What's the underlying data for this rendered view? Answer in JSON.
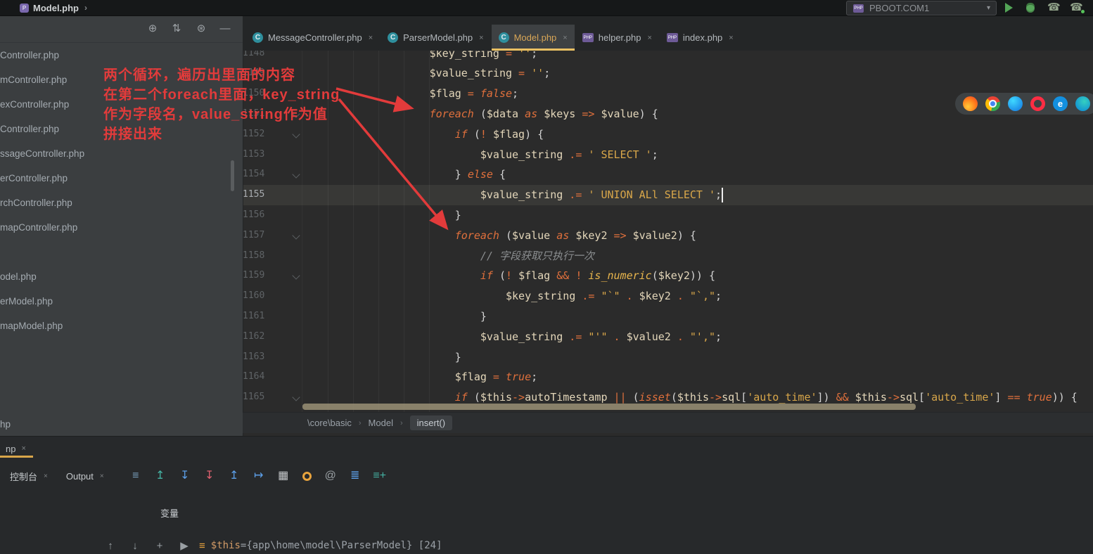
{
  "title_bar": {
    "title": "Model.php",
    "chevron": "›",
    "run_config": {
      "label": "PBOOT.COM1",
      "caret": "▾"
    }
  },
  "project_panel": {
    "toolbar_icons": [
      {
        "name": "locate-file-icon",
        "glyph": "⊕"
      },
      {
        "name": "collapse-all-icon",
        "glyph": "⇅"
      },
      {
        "name": "settings-icon",
        "glyph": "⊛"
      },
      {
        "name": "hide-panel-icon",
        "glyph": "—"
      }
    ],
    "files": [
      "Controller.php",
      "mController.php",
      "exController.php",
      "Controller.php",
      "ssageController.php",
      "erController.php",
      "rchController.php",
      "mapController.php",
      "odel.php",
      "erModel.php",
      "mapModel.php",
      "hp"
    ]
  },
  "editor_tabs": {
    "class_icon_letter": "C",
    "php_icon_letter": "PHP",
    "items": [
      {
        "label": "MessageController.php",
        "kind": "class",
        "close": "×"
      },
      {
        "label": "ParserModel.php",
        "kind": "class",
        "close": "×"
      },
      {
        "label": "Model.php",
        "kind": "class",
        "close": "×",
        "active": true
      },
      {
        "label": "helper.php",
        "kind": "php",
        "close": "×"
      },
      {
        "label": "index.php",
        "kind": "php",
        "close": "×"
      }
    ]
  },
  "editor": {
    "current_line": "1155",
    "breadcrumbs": [
      "\\core\\basic",
      "Model",
      "insert()"
    ],
    "lines": [
      {
        "n": "1148",
        "t": [
          [
            "sp",
            20
          ],
          [
            "var",
            "$key_string"
          ],
          [
            "op",
            " = "
          ],
          [
            "str",
            "''"
          ],
          [
            "pun",
            ";"
          ]
        ]
      },
      {
        "n": "1149",
        "t": [
          [
            "sp",
            20
          ],
          [
            "var",
            "$value_string"
          ],
          [
            "op",
            " = "
          ],
          [
            "str",
            "''"
          ],
          [
            "pun",
            ";"
          ]
        ]
      },
      {
        "n": "1150",
        "t": [
          [
            "sp",
            20
          ],
          [
            "var",
            "$flag"
          ],
          [
            "op",
            " = "
          ],
          [
            "kw",
            "false"
          ],
          [
            "pun",
            ";"
          ]
        ]
      },
      {
        "n": "1151",
        "t": [
          [
            "sp",
            20
          ],
          [
            "kw",
            "foreach"
          ],
          [
            "pun",
            " ("
          ],
          [
            "var",
            "$data"
          ],
          [
            "kw",
            " as "
          ],
          [
            "var",
            "$keys"
          ],
          [
            "op",
            " => "
          ],
          [
            "var",
            "$value"
          ],
          [
            "pun",
            ") {"
          ]
        ]
      },
      {
        "n": "1152",
        "t": [
          [
            "sp",
            24
          ],
          [
            "kw",
            "if"
          ],
          [
            "pun",
            " ("
          ],
          [
            "op",
            "! "
          ],
          [
            "var",
            "$flag"
          ],
          [
            "pun",
            ") {"
          ]
        ]
      },
      {
        "n": "1153",
        "t": [
          [
            "sp",
            28
          ],
          [
            "var",
            "$value_string"
          ],
          [
            "op",
            " .= "
          ],
          [
            "str",
            "' SELECT '"
          ],
          [
            "pun",
            ";"
          ]
        ]
      },
      {
        "n": "1154",
        "t": [
          [
            "sp",
            24
          ],
          [
            "pun",
            "} "
          ],
          [
            "kw",
            "else"
          ],
          [
            "pun",
            " {"
          ]
        ]
      },
      {
        "n": "1155",
        "t": [
          [
            "sp",
            28
          ],
          [
            "var",
            "$value_string"
          ],
          [
            "op",
            " .= "
          ],
          [
            "str",
            "' UNION ALl SELECT '"
          ],
          [
            "pun",
            ";"
          ]
        ]
      },
      {
        "n": "1156",
        "t": [
          [
            "sp",
            24
          ],
          [
            "pun",
            "}"
          ]
        ]
      },
      {
        "n": "1157",
        "t": [
          [
            "sp",
            24
          ],
          [
            "kw",
            "foreach"
          ],
          [
            "pun",
            " ("
          ],
          [
            "var",
            "$value"
          ],
          [
            "kw",
            " as "
          ],
          [
            "var",
            "$key2"
          ],
          [
            "op",
            " => "
          ],
          [
            "var",
            "$value2"
          ],
          [
            "pun",
            ") {"
          ]
        ]
      },
      {
        "n": "1158",
        "t": [
          [
            "sp",
            28
          ],
          [
            "com",
            "// 字段获取只执行一次"
          ]
        ]
      },
      {
        "n": "1159",
        "t": [
          [
            "sp",
            28
          ],
          [
            "kw",
            "if"
          ],
          [
            "pun",
            " ("
          ],
          [
            "op",
            "! "
          ],
          [
            "var",
            "$flag"
          ],
          [
            "op",
            " && "
          ],
          [
            "op",
            "! "
          ],
          [
            "fn",
            "is_numeric"
          ],
          [
            "pun",
            "("
          ],
          [
            "var",
            "$key2"
          ],
          [
            "pun",
            ")) {"
          ]
        ]
      },
      {
        "n": "1160",
        "t": [
          [
            "sp",
            32
          ],
          [
            "var",
            "$key_string"
          ],
          [
            "op",
            " .= "
          ],
          [
            "str",
            "\"`\""
          ],
          [
            "op",
            " . "
          ],
          [
            "var",
            "$key2"
          ],
          [
            "op",
            " . "
          ],
          [
            "str",
            "\"`,\""
          ],
          [
            "pun",
            ";"
          ]
        ]
      },
      {
        "n": "1161",
        "t": [
          [
            "sp",
            28
          ],
          [
            "pun",
            "}"
          ]
        ]
      },
      {
        "n": "1162",
        "t": [
          [
            "sp",
            28
          ],
          [
            "var",
            "$value_string"
          ],
          [
            "op",
            " .= "
          ],
          [
            "str",
            "\"'\""
          ],
          [
            "op",
            " . "
          ],
          [
            "var",
            "$value2"
          ],
          [
            "op",
            " . "
          ],
          [
            "str",
            "\"',\""
          ],
          [
            "pun",
            ";"
          ]
        ]
      },
      {
        "n": "1163",
        "t": [
          [
            "sp",
            24
          ],
          [
            "pun",
            "}"
          ]
        ]
      },
      {
        "n": "1164",
        "t": [
          [
            "sp",
            24
          ],
          [
            "var",
            "$flag"
          ],
          [
            "op",
            " = "
          ],
          [
            "kw",
            "true"
          ],
          [
            "pun",
            ";"
          ]
        ]
      },
      {
        "n": "1165",
        "t": [
          [
            "sp",
            24
          ],
          [
            "kw",
            "if"
          ],
          [
            "pun",
            " ("
          ],
          [
            "var",
            "$this"
          ],
          [
            "op",
            "->"
          ],
          [
            "var",
            "autoTimestamp"
          ],
          [
            "op",
            " || "
          ],
          [
            "pun",
            "("
          ],
          [
            "kw",
            "isset"
          ],
          [
            "pun",
            "("
          ],
          [
            "var",
            "$this"
          ],
          [
            "op",
            "->"
          ],
          [
            "var",
            "sql"
          ],
          [
            "pun",
            "["
          ],
          [
            "str",
            "'auto_time'"
          ],
          [
            "pun",
            "])"
          ],
          [
            "op",
            " && "
          ],
          [
            "var",
            "$this"
          ],
          [
            "op",
            "->"
          ],
          [
            "var",
            "sql"
          ],
          [
            "pun",
            "["
          ],
          [
            "str",
            "'auto_time'"
          ],
          [
            "pun",
            "]"
          ],
          [
            "op",
            " == "
          ],
          [
            "kw",
            "true"
          ],
          [
            "pun",
            ")) {"
          ]
        ]
      }
    ]
  },
  "annotations": {
    "lines": [
      "两个循环，遍历出里面的内容",
      "在第二个foreach里面，key_string",
      "作为字段名，value_string作为值",
      "拼接出来"
    ]
  },
  "browser_popup": [
    {
      "name": "firefox-icon",
      "cls": "b-firefox",
      "letter": ""
    },
    {
      "name": "chrome-icon",
      "cls": "b-chrome",
      "letter": ""
    },
    {
      "name": "safari-icon",
      "cls": "b-safari",
      "letter": ""
    },
    {
      "name": "opera-icon",
      "cls": "b-opera",
      "letter": ""
    },
    {
      "name": "edge-icon",
      "cls": "b-edge",
      "letter": "e"
    },
    {
      "name": "edge-dev-icon",
      "cls": "b-edgedev",
      "letter": ""
    }
  ],
  "debug_panel": {
    "tab": "np",
    "tab_close": "×",
    "console_tab": "控制台",
    "console_close": "×",
    "output_tab": "Output",
    "output_close": "×",
    "variables_label": "变量",
    "toolbar_icons": [
      {
        "name": "view-options-icon",
        "glyph": "≡",
        "color": "#7ba3c0"
      },
      {
        "name": "show-execution-point-icon",
        "glyph": "↥",
        "color": "#45b3a4"
      },
      {
        "name": "step-into-icon",
        "glyph": "↧",
        "color": "#5c9fe8"
      },
      {
        "name": "force-step-into-icon",
        "glyph": "↧",
        "color": "#e06070"
      },
      {
        "name": "step-out-icon",
        "glyph": "↥",
        "color": "#5c9fe8"
      },
      {
        "name": "run-to-cursor-icon",
        "glyph": "↦",
        "color": "#5c9fe8"
      },
      {
        "name": "view-as-table-icon",
        "glyph": "▦",
        "color": "#c4c7c9"
      },
      {
        "name": "coin-icon",
        "glyph": "",
        "color": "#e8a33d",
        "ring": true
      },
      {
        "name": "mention-icon",
        "glyph": "@",
        "color": "#9aa0a4"
      },
      {
        "name": "numbered-list-icon",
        "glyph": "≣",
        "color": "#5c9fe8"
      },
      {
        "name": "add-to-watches-icon",
        "glyph": "≡+",
        "color": "#45b3a4"
      }
    ],
    "vars_toolbar": [
      {
        "name": "navigate-up-icon",
        "glyph": "↑"
      },
      {
        "name": "navigate-down-icon",
        "glyph": "↓"
      },
      {
        "name": "add-watch-icon",
        "glyph": "+"
      },
      {
        "name": "evaluate-icon",
        "glyph": "▶"
      }
    ],
    "variable": {
      "name": "$this",
      "eq": " = ",
      "value": "{app\\home\\model\\ParserModel} [24]"
    }
  }
}
